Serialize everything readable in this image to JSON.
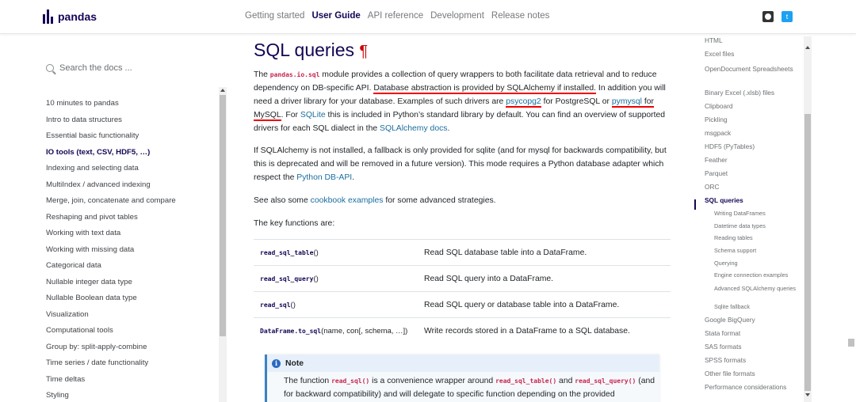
{
  "brand": {
    "name": "pandas",
    "color": "#150458"
  },
  "nav": [
    {
      "label": "Getting started",
      "active": false
    },
    {
      "label": "User Guide",
      "active": true
    },
    {
      "label": "API reference",
      "active": false
    },
    {
      "label": "Development",
      "active": false
    },
    {
      "label": "Release notes",
      "active": false
    }
  ],
  "icons": {
    "github": "github-icon",
    "twitter": "twitter-icon",
    "search": "search-icon",
    "note": "info-icon"
  },
  "search": {
    "placeholder": "Search the docs ..."
  },
  "left_nav": [
    {
      "label": "10 minutes to pandas"
    },
    {
      "label": "Intro to data structures"
    },
    {
      "label": "Essential basic functionality"
    },
    {
      "label": "IO tools (text, CSV, HDF5, …)",
      "active": true
    },
    {
      "label": "Indexing and selecting data"
    },
    {
      "label": "MultiIndex / advanced indexing"
    },
    {
      "label": "Merge, join, concatenate and compare"
    },
    {
      "label": "Reshaping and pivot tables"
    },
    {
      "label": "Working with text data"
    },
    {
      "label": "Working with missing data"
    },
    {
      "label": "Categorical data"
    },
    {
      "label": "Nullable integer data type"
    },
    {
      "label": "Nullable Boolean data type"
    },
    {
      "label": "Visualization"
    },
    {
      "label": "Computational tools"
    },
    {
      "label": "Group by: split-apply-combine"
    },
    {
      "label": "Time series / date functionality"
    },
    {
      "label": "Time deltas"
    },
    {
      "label": "Styling"
    }
  ],
  "main": {
    "title": "SQL queries",
    "pilcrow": "¶",
    "p1": {
      "t1": "The ",
      "code": "pandas.io.sql",
      "t2": " module provides a collection of query wrappers to both facilitate data retrieval and to reduce dependency on DB-specific API. ",
      "t3": "Database abstraction is provided by SQLAlchemy if installed.",
      "t4": " In addition you will need a driver library for your database. Examples of such drivers are ",
      "link1": "psycopg2",
      "t5": " for PostgreSQL or ",
      "link2": "pymysql",
      "t6": " for MySQL",
      "t7": ". For ",
      "link3": "SQLite",
      "t8": " this is included in Python’s standard library by default. You can find an overview of supported drivers for each SQL dialect in the ",
      "link4": "SQLAlchemy docs",
      "t9": "."
    },
    "p2": {
      "t1": "If SQLAlchemy is not installed, a fallback is only provided for sqlite (and for mysql for backwards compatibility, but this is deprecated and will be removed in a future version). This mode requires a Python database adapter which respect the ",
      "link": "Python DB-API",
      "t2": "."
    },
    "p3": {
      "t1": "See also some ",
      "link": "cookbook examples",
      "t2": " for some advanced strategies."
    },
    "p4": "The key functions are:",
    "functions": [
      {
        "name": "read_sql_table",
        "rest": "()",
        "desc": "Read SQL database table into a DataFrame."
      },
      {
        "name": "read_sql_query",
        "rest": "()",
        "desc": "Read SQL query into a DataFrame."
      },
      {
        "name": "read_sql",
        "rest": "()",
        "desc": "Read SQL query or database table into a DataFrame."
      },
      {
        "name": "DataFrame.to_sql",
        "rest": "(name, con[, schema, …])",
        "desc": "Write records stored in a DataFrame to a SQL database."
      }
    ],
    "note": {
      "heading": "Note",
      "t1": "The function ",
      "code1": "read_sql()",
      "t2": " is a convenience wrapper around ",
      "code2": "read_sql_table()",
      "t3": " and ",
      "code3": "read_sql_query()",
      "t4": " (and for backward compatibility) and will delegate to specific function depending on the provided"
    }
  },
  "toc": [
    {
      "label": "HTML"
    },
    {
      "label": "Excel files"
    },
    {
      "label": "OpenDocument Spreadsheets"
    },
    {
      "label": "Binary Excel (.xlsb) files"
    },
    {
      "label": "Clipboard"
    },
    {
      "label": "Pickling"
    },
    {
      "label": "msgpack"
    },
    {
      "label": "HDF5 (PyTables)"
    },
    {
      "label": "Feather"
    },
    {
      "label": "Parquet"
    },
    {
      "label": "ORC"
    },
    {
      "label": "SQL queries",
      "active": true
    },
    {
      "label": "Writing DataFrames",
      "sub": true
    },
    {
      "label": "Datetime data types",
      "sub": true
    },
    {
      "label": "Reading tables",
      "sub": true
    },
    {
      "label": "Schema support",
      "sub": true
    },
    {
      "label": "Querying",
      "sub": true
    },
    {
      "label": "Engine connection examples",
      "sub": true
    },
    {
      "label": "Advanced SQLAlchemy queries",
      "sub": true
    },
    {
      "label": "Sqlite fallback",
      "sub": true
    },
    {
      "label": "Google BigQuery"
    },
    {
      "label": "Stata format"
    },
    {
      "label": "SAS formats"
    },
    {
      "label": "SPSS formats"
    },
    {
      "label": "Other file formats"
    },
    {
      "label": "Performance considerations"
    }
  ]
}
